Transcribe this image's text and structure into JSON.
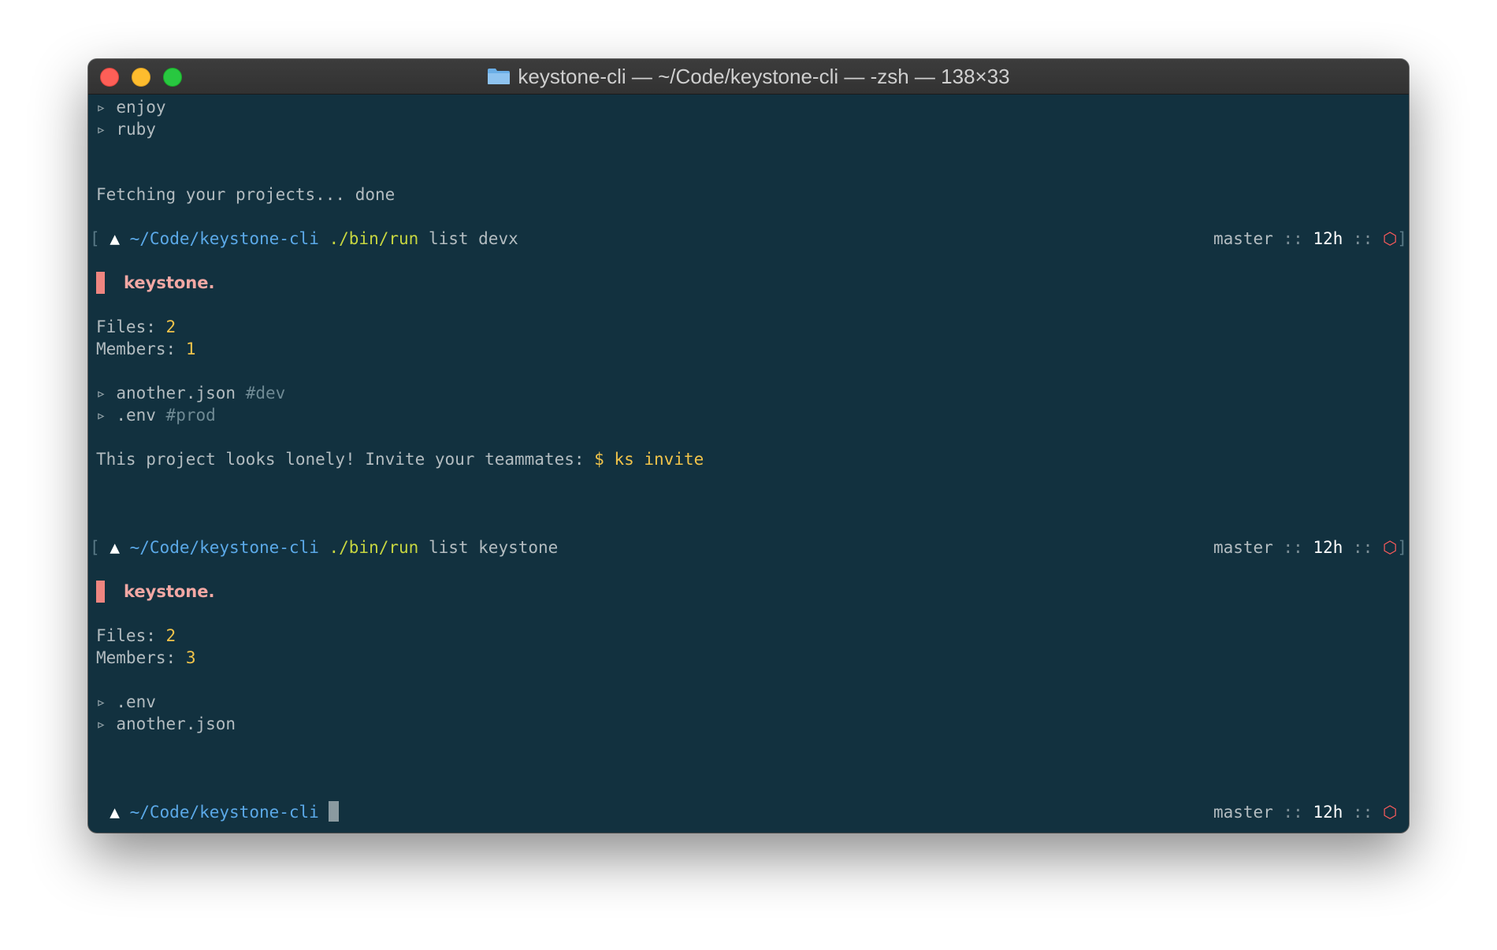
{
  "window": {
    "title": "keystone-cli — ~/Code/keystone-cli — -zsh — 138×33",
    "folder_icon": "folder-icon"
  },
  "colors": {
    "background": "#12313f",
    "path": "#5ba9e8",
    "command": "#c7d640",
    "number": "#f0c34a",
    "brand": "#f3a8a4",
    "hexagon": "#ff5b5b"
  },
  "terminal": {
    "bullet": "▹",
    "prompt_symbol": "▲",
    "open_bracket": "[",
    "close_bracket": "]",
    "top_list": [
      "enjoy",
      "ruby"
    ],
    "fetch_status": "Fetching your projects... done",
    "status": {
      "branch": "master",
      "separator": "::",
      "age": "12h",
      "hexagon": "⬡"
    },
    "blocks": [
      {
        "cwd": "~/Code/keystone-cli",
        "command": "./bin/run",
        "args": "list devx",
        "brand": "keystone.",
        "files_label": "Files:",
        "files_value": "2",
        "members_label": "Members:",
        "members_value": "1",
        "files": [
          {
            "name": "another.json",
            "tag": "#dev"
          },
          {
            "name": ".env",
            "tag": "#prod"
          }
        ],
        "lonely_message": "This project looks lonely! Invite your teammates:",
        "invite_command": "$ ks invite"
      },
      {
        "cwd": "~/Code/keystone-cli",
        "command": "./bin/run",
        "args": "list keystone",
        "brand": "keystone.",
        "files_label": "Files:",
        "files_value": "2",
        "members_label": "Members:",
        "members_value": "3",
        "files": [
          {
            "name": ".env"
          },
          {
            "name": "another.json"
          }
        ]
      }
    ],
    "final_prompt": {
      "cwd": "~/Code/keystone-cli"
    }
  }
}
